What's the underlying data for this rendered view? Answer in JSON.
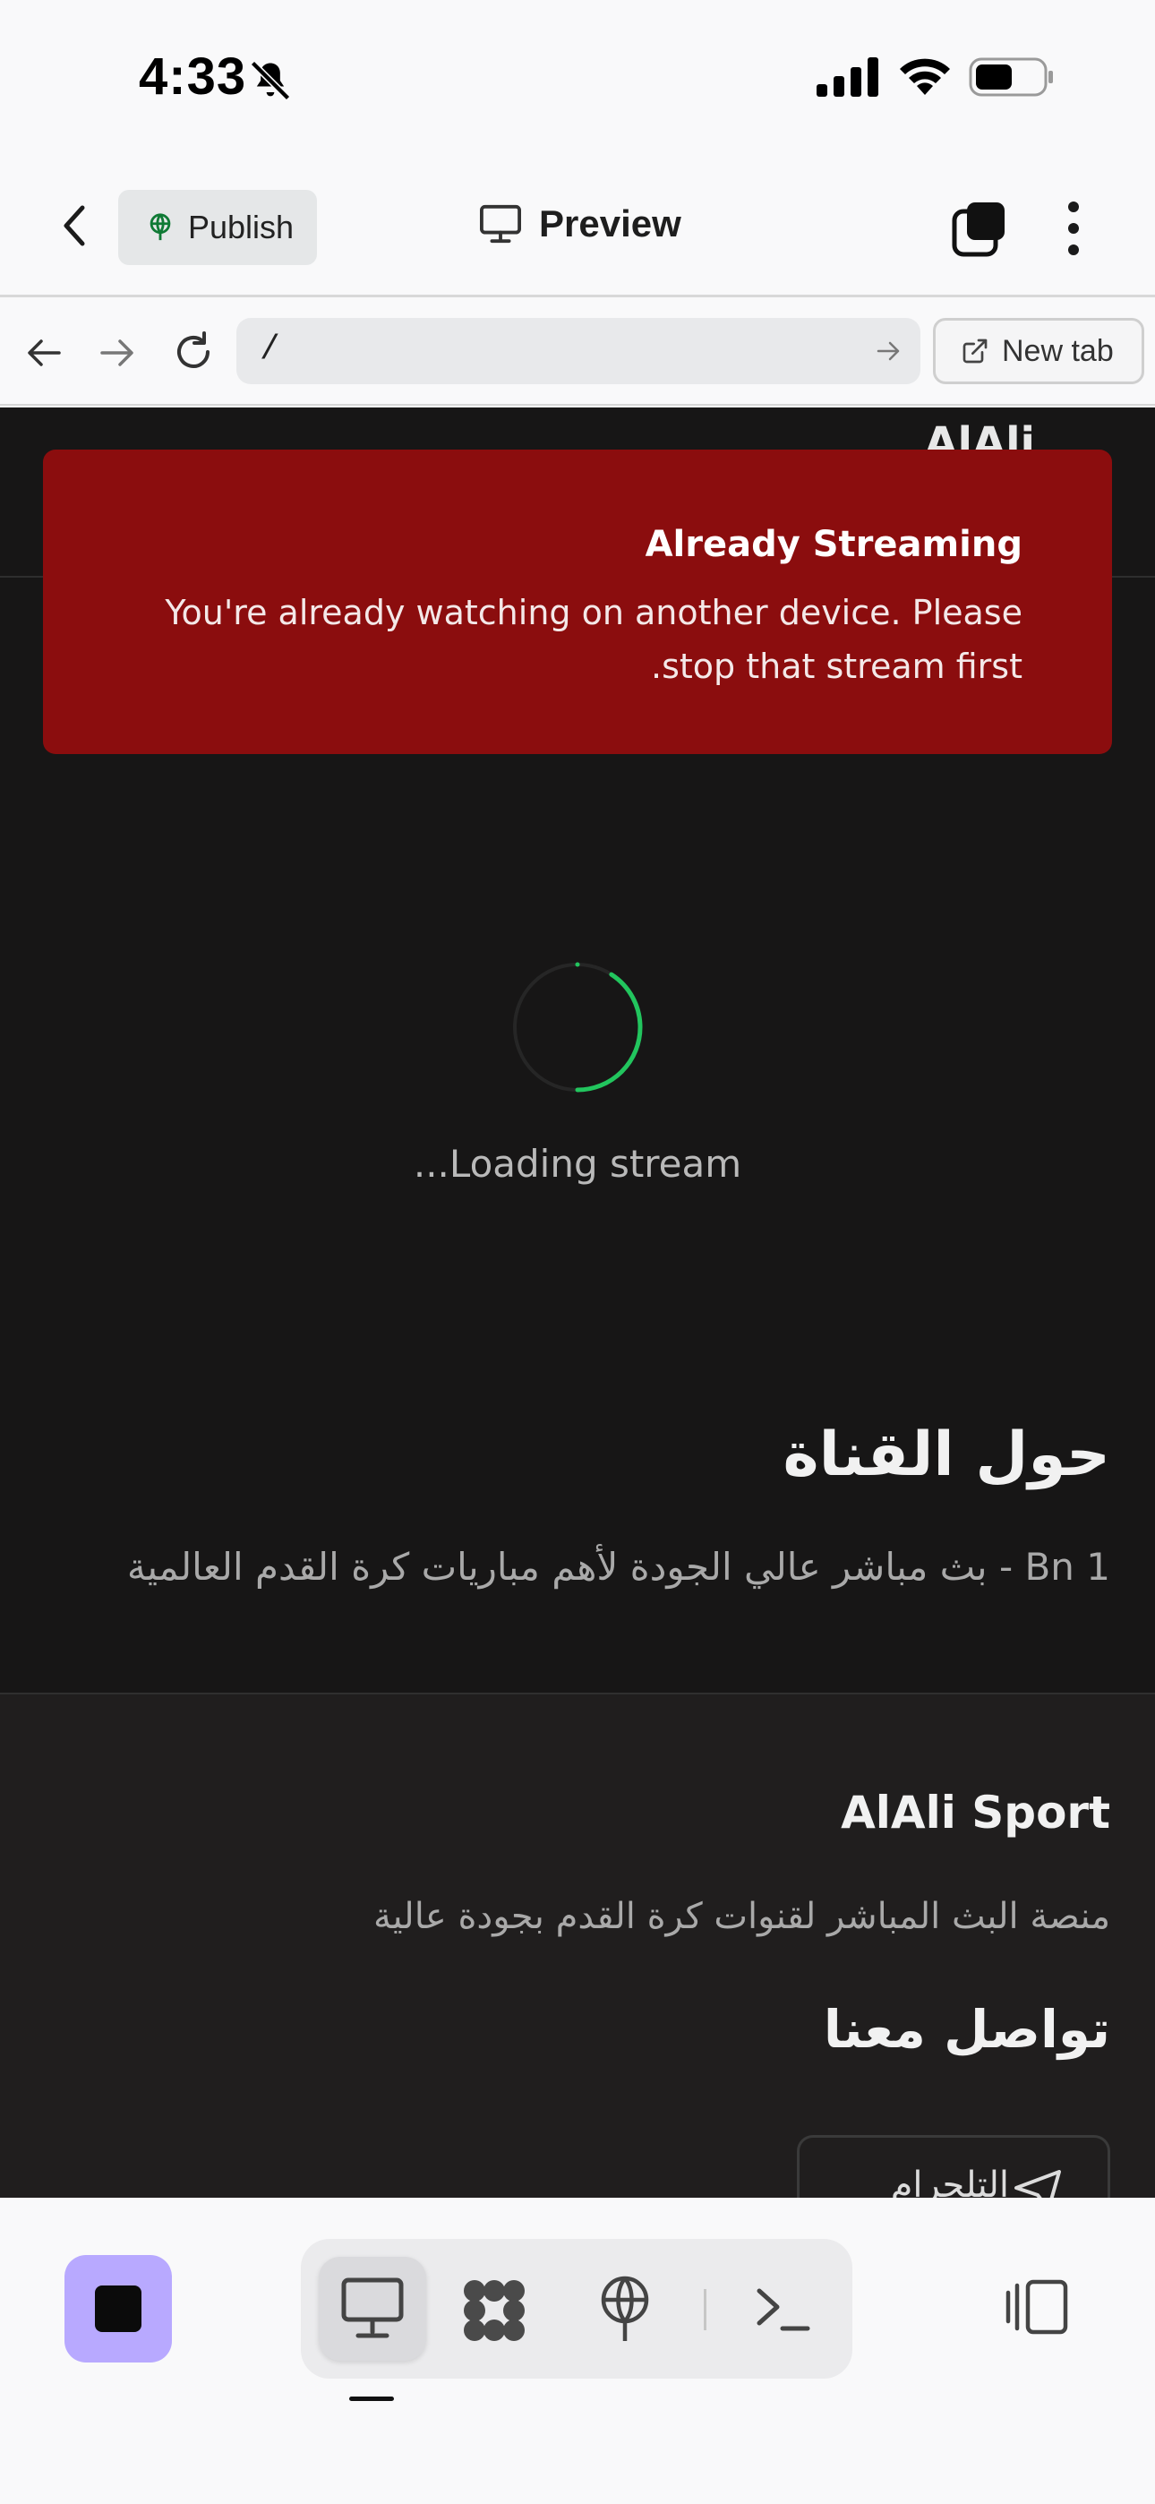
{
  "status_bar": {
    "time": "4:33"
  },
  "toolbar": {
    "publish_label": "Publish",
    "preview_label": "Preview"
  },
  "address_bar": {
    "url": "/",
    "new_tab_label": "New tab"
  },
  "site": {
    "logo_text": "AlAli",
    "toast": {
      "title": "Already Streaming",
      "message": "You're already watching on another device. Please stop that stream first."
    },
    "loading_text": "Loading stream...",
    "about_title": "حول القناة",
    "about_text": "Bn 1 - بث مباشر عالي الجودة لأهم مباريات كرة القدم العالمية",
    "footer": {
      "brand": "AlAli Sport",
      "description": "منصة البث المباشر لقنوات كرة القدم بجودة عالية",
      "contact_title": "تواصل معنا",
      "contact_button": "التلجرام"
    }
  },
  "colors": {
    "toast_bg": "#8b0d0e",
    "page_bg": "#171616",
    "footer_bg": "#201e1e",
    "spinner_accent": "#22c55e",
    "stop_button": "#b8a9ff"
  },
  "icons": [
    "bell-slash-icon",
    "signal-icon",
    "wifi-icon",
    "battery-icon",
    "chevron-left-icon",
    "globe-icon",
    "monitor-icon",
    "tabs-icon",
    "more-vertical-icon",
    "arrow-left-icon",
    "arrow-right-icon",
    "reload-icon",
    "external-link-icon",
    "send-icon",
    "stop-icon",
    "blocks-icon",
    "terminal-icon",
    "panel-icon"
  ]
}
